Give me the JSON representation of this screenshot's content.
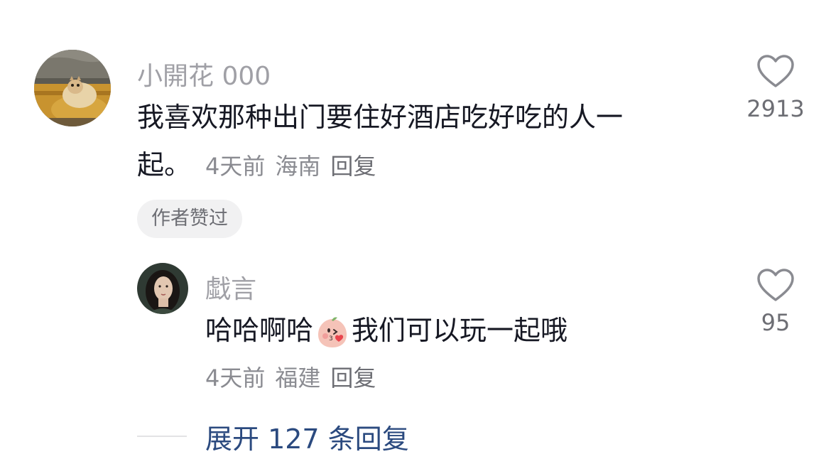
{
  "comments": [
    {
      "username": "小開花 000",
      "text_line1": "我喜欢那种出门要住好酒店吃好吃的人一",
      "text_line2": "起。",
      "time": "4天前",
      "location": "海南",
      "reply_label": "回复",
      "like_count": "2913",
      "badge": "作者赞过",
      "avatar_icon": "cat-on-hat-photo",
      "replies": [
        {
          "username": "戱言",
          "text_before_emoji": "哈哈啊哈",
          "emoji": "kiss-peach-emoji",
          "text_after_emoji": "我们可以玩一起哦",
          "time": "4天前",
          "location": "福建",
          "reply_label": "回复",
          "like_count": "95",
          "avatar_icon": "woman-portrait-photo"
        }
      ]
    }
  ],
  "expand_replies_label": "展开 127 条回复",
  "like_icon": "heart-outline-icon"
}
